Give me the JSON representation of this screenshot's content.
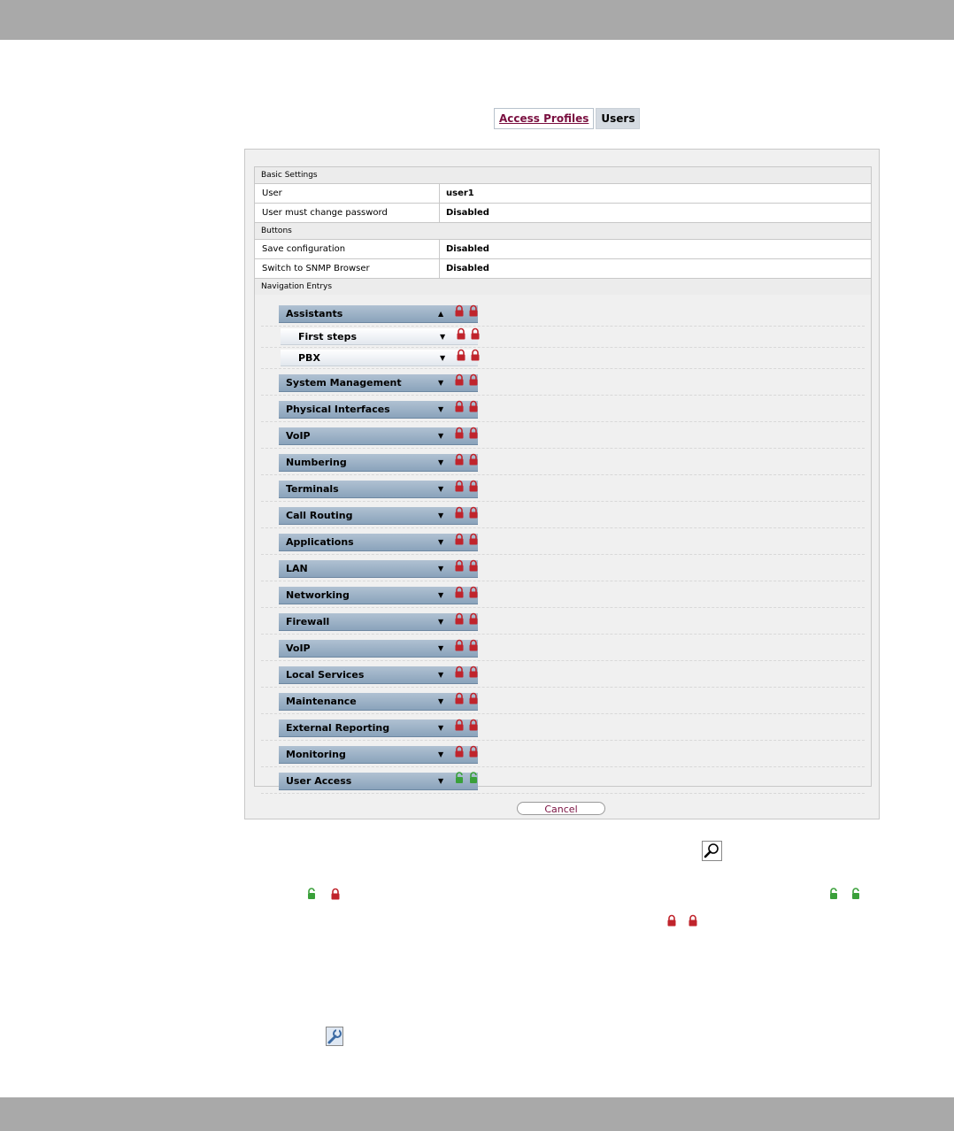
{
  "tabs": [
    {
      "label": "Access Profiles"
    },
    {
      "label": "Users"
    }
  ],
  "basic_settings": {
    "header": "Basic Settings",
    "user_label": "User",
    "user_value": "user1",
    "change_pw_label": "User must change password",
    "change_pw_value": "Disabled"
  },
  "buttons_section": {
    "header": "Buttons",
    "save_label": "Save configuration",
    "save_value": "Disabled",
    "snmp_label": "Switch to SNMP Browser",
    "snmp_value": "Disabled"
  },
  "navigation": {
    "header": "Navigation Entrys",
    "items": [
      {
        "label": "Assistants",
        "arrow": "▲",
        "lock": "locked"
      },
      {
        "label": "First steps",
        "arrow": "▼",
        "lock": "locked"
      },
      {
        "label": "PBX",
        "arrow": "▼",
        "lock": "locked"
      },
      {
        "label": "System Management",
        "arrow": "▼",
        "lock": "locked"
      },
      {
        "label": "Physical Interfaces",
        "arrow": "▼",
        "lock": "locked"
      },
      {
        "label": "VoIP",
        "arrow": "▼",
        "lock": "locked"
      },
      {
        "label": "Numbering",
        "arrow": "▼",
        "lock": "locked"
      },
      {
        "label": "Terminals",
        "arrow": "▼",
        "lock": "locked"
      },
      {
        "label": "Call Routing",
        "arrow": "▼",
        "lock": "locked"
      },
      {
        "label": "Applications",
        "arrow": "▼",
        "lock": "locked"
      },
      {
        "label": "LAN",
        "arrow": "▼",
        "lock": "locked"
      },
      {
        "label": "Networking",
        "arrow": "▼",
        "lock": "locked"
      },
      {
        "label": "Firewall",
        "arrow": "▼",
        "lock": "locked"
      },
      {
        "label": "VoIP",
        "arrow": "▼",
        "lock": "locked"
      },
      {
        "label": "Local Services",
        "arrow": "▼",
        "lock": "locked"
      },
      {
        "label": "Maintenance",
        "arrow": "▼",
        "lock": "locked"
      },
      {
        "label": "External Reporting",
        "arrow": "▼",
        "lock": "locked"
      },
      {
        "label": "Monitoring",
        "arrow": "▼",
        "lock": "locked"
      },
      {
        "label": "User Access",
        "arrow": "▼",
        "lock": "unlocked"
      }
    ]
  },
  "cancel_label": "Cancel",
  "colors": {
    "lock_locked": "#c0242c",
    "lock_unlocked": "#3aa03a",
    "tab_link": "#7a1040",
    "nav_button": "#9cb2c8"
  },
  "icons": {
    "magnifier": "search-icon",
    "wrench": "wrench-icon",
    "lock_red": "lock-locked-icon",
    "lock_green": "lock-unlocked-icon"
  }
}
